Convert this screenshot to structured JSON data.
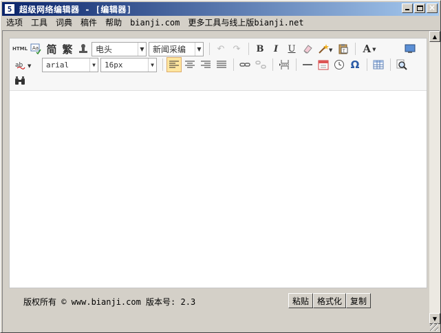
{
  "window": {
    "title": "超级网络编辑器 - [编辑器]",
    "app_icon_glyph": "5"
  },
  "menu": [
    "选项",
    "工具",
    "词典",
    "稿件",
    "帮助",
    "bianji.com",
    "更多工具与线上版bianji.net"
  ],
  "toolbar": {
    "html_label": "HTML",
    "jian_label": "简",
    "fan_label": "繁",
    "style_select": "电头",
    "source_select": "新闻采编",
    "bold": "B",
    "italic": "I",
    "underline": "U",
    "fontcolor": "A",
    "font_select": "arial",
    "size_select": "16px",
    "omega": "Ω"
  },
  "footer": {
    "copyright": "版权所有 © www.bianji.com 版本号: 2.3",
    "paste": "粘贴",
    "format": "格式化",
    "copy": "复制"
  }
}
